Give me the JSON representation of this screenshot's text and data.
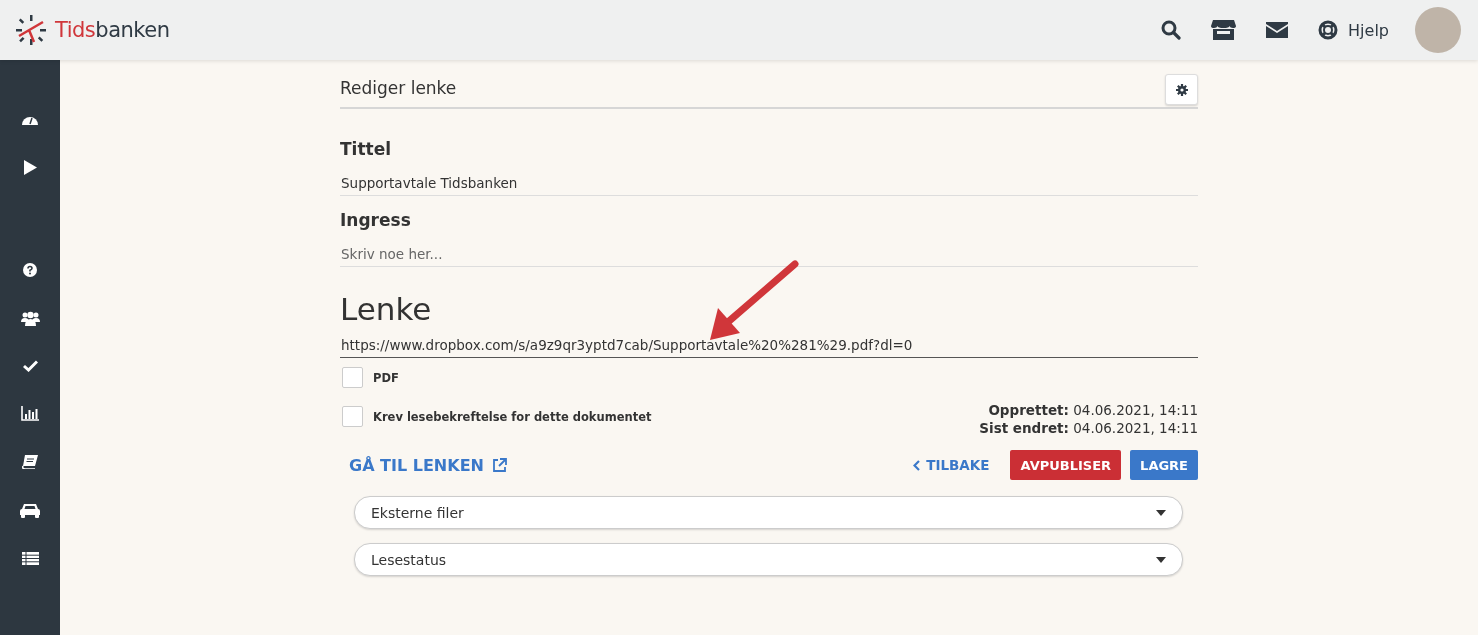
{
  "header": {
    "logo": {
      "part_1": "Tids",
      "part_2": "banken"
    },
    "help_link": "Hjelp"
  },
  "sidebar": {
    "items": [
      {
        "kind": "dashboard"
      },
      {
        "kind": "play"
      },
      {
        "kind": "spacer"
      },
      {
        "kind": "help"
      },
      {
        "kind": "users"
      },
      {
        "kind": "check"
      },
      {
        "kind": "chart"
      },
      {
        "kind": "book"
      },
      {
        "kind": "car"
      },
      {
        "kind": "list"
      }
    ]
  },
  "page": {
    "title": "Rediger lenke",
    "fields": [
      {
        "label": "Tittel",
        "value": "Supportavtale Tidsbanken"
      },
      {
        "label": "Ingress",
        "placeholder": "Skriv noe her..."
      }
    ],
    "link": {
      "label": "Lenke",
      "value": "https://www.dropbox.com/s/a9z9qr3yptd7cab/Supportavtale%20%281%29.pdf?dl=0"
    },
    "checkboxes": [
      {
        "label": "PDF",
        "checked": false
      },
      {
        "label": "Krev lesebekreftelse for dette dokumentet",
        "checked": false
      }
    ],
    "meta": [
      {
        "label": "Opprettet:",
        "value": "04.06.2021, 14:11"
      },
      {
        "label": "Sist endret:",
        "value": "04.06.2021, 14:11"
      }
    ],
    "go_to_link": "GÅ TIL LENKEN",
    "buttons": [
      {
        "kind": "back",
        "label": "TILBAKE"
      },
      {
        "kind": "danger",
        "label": "AVPUBLISER"
      },
      {
        "kind": "primary",
        "label": "LAGRE"
      }
    ],
    "dropdowns": [
      {
        "label": "Eksterne filer"
      },
      {
        "label": "Lesestatus"
      }
    ]
  }
}
